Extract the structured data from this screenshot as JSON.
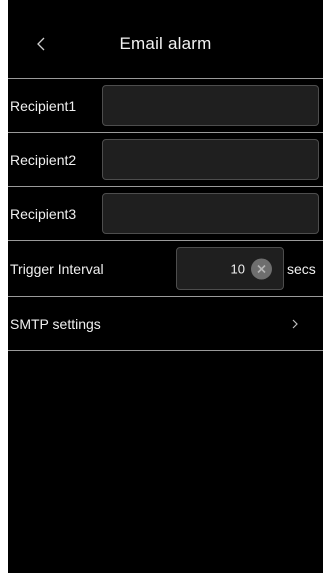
{
  "header": {
    "title": "Email alarm",
    "back_icon": "chevron-left-icon"
  },
  "recipients": [
    {
      "label": "Recipient1",
      "value": ""
    },
    {
      "label": "Recipient2",
      "value": ""
    },
    {
      "label": "Recipient3",
      "value": ""
    }
  ],
  "trigger": {
    "label": "Trigger Interval",
    "value": "10",
    "unit": "secs",
    "clear_icon": "clear-icon"
  },
  "smtp": {
    "label": "SMTP settings",
    "chevron_icon": "chevron-right-icon"
  },
  "colors": {
    "background": "#000000",
    "divider": "#9a9a9a",
    "input_background": "#1f1f1f",
    "input_border": "#4d4d4d",
    "text": "#f0f0f0",
    "clear_button": "#6e6e6e"
  }
}
